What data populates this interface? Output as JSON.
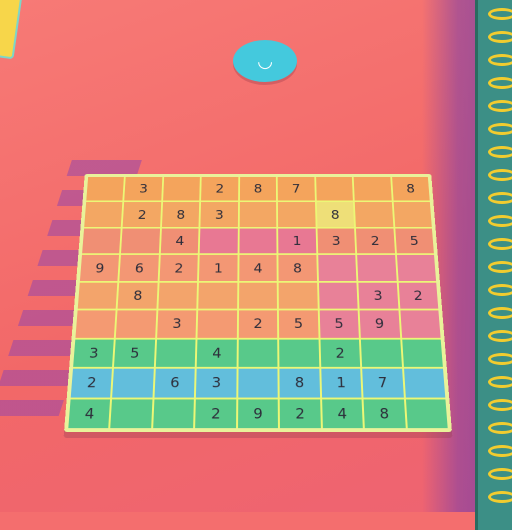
{
  "badge": {
    "icon": "smile-icon",
    "glyph": "◡"
  },
  "board": {
    "rows": [
      [
        "",
        "3",
        "",
        "2",
        "8",
        "7",
        "",
        "",
        "8"
      ],
      [
        "",
        "2",
        "8",
        "3",
        "",
        "",
        "8",
        "",
        ""
      ],
      [
        "",
        "",
        "4",
        "",
        "",
        "1",
        "3",
        "2",
        "5"
      ],
      [
        "9",
        "6",
        "2",
        "1",
        "4",
        "8",
        "",
        "",
        ""
      ],
      [
        "",
        "8",
        "",
        "",
        "",
        "",
        "",
        "3",
        "2"
      ],
      [
        "",
        "",
        "3",
        "",
        "2",
        "5",
        "5",
        "9",
        ""
      ],
      [
        "3",
        "5",
        "",
        "4",
        "",
        "",
        "2",
        "",
        ""
      ],
      [
        "2",
        "",
        "6",
        "3",
        "",
        "8",
        "1",
        "7",
        ""
      ],
      [
        "4",
        "",
        "",
        "2",
        "9",
        "2",
        "4",
        "8",
        ""
      ]
    ]
  },
  "colors": {
    "background": "#f26868",
    "board_outline": "#ecf776",
    "warm_rows": "#f4a45c",
    "green_rows": "#58c98a",
    "blue_row": "#62bedc",
    "badge": "#44c9dd",
    "notebook_rings": "#f2cc2f"
  }
}
